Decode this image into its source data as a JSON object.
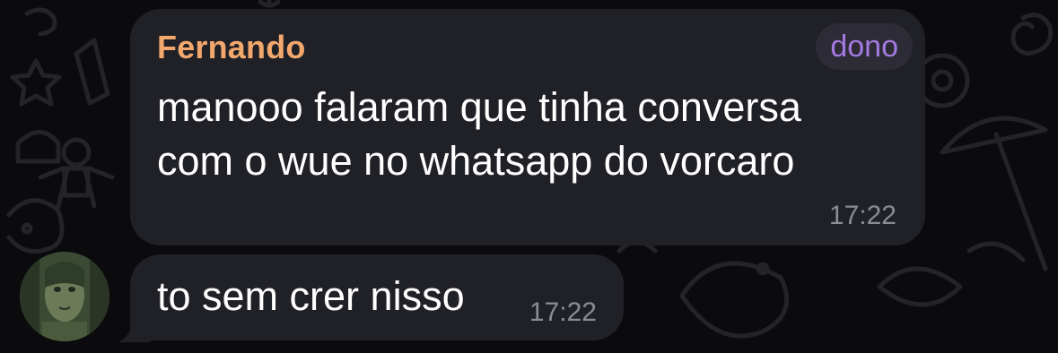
{
  "chat": {
    "messages": [
      {
        "sender": "Fernando",
        "role_badge": "dono",
        "text_lines": [
          "manooo falaram que tinha conversa",
          "com o wue no whatsapp do vorcaro"
        ],
        "time": "17:22"
      },
      {
        "text": "to sem crer nisso",
        "time": "17:22",
        "avatar_icon": "user-avatar-photo"
      }
    ]
  },
  "colors": {
    "background": "#0b0b0d",
    "bubble": "#202027",
    "sender_name": "#f2a86c",
    "role_badge_text": "#a27ae0",
    "role_badge_bg": "#2d2b36",
    "message_text": "#ffffff",
    "timestamp": "#8b8b93"
  }
}
